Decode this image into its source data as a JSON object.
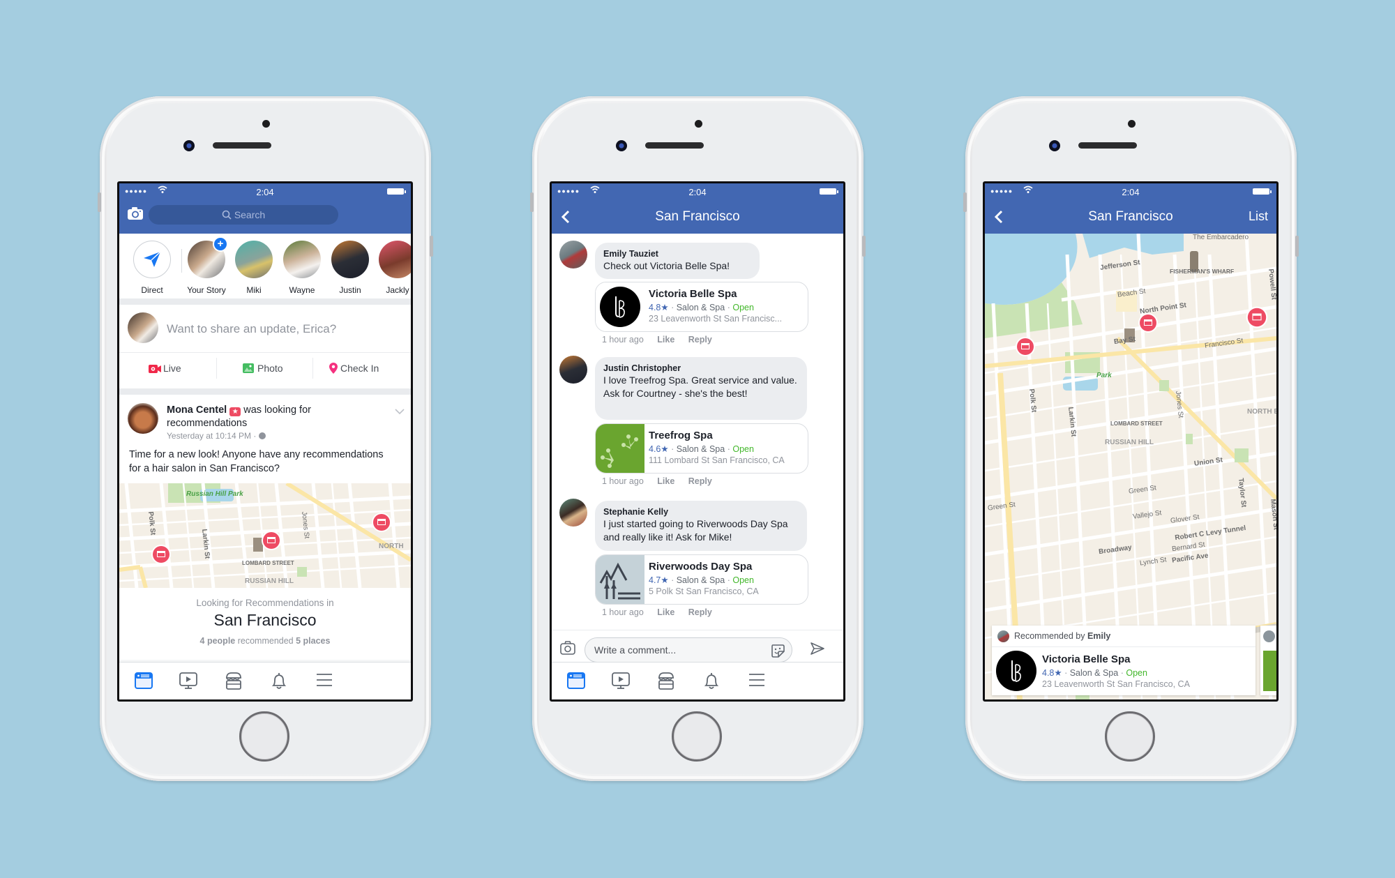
{
  "colors": {
    "background": "#a4cde0",
    "fb_blue": "#4267b2",
    "pin_red": "#ee4b63",
    "open_green": "#42b72a"
  },
  "status_bar": {
    "time": "2:04",
    "signal": "●●●●●",
    "wifi_icon": "wifi-icon",
    "battery_icon": "battery-icon"
  },
  "phone1": {
    "search_placeholder": "Search",
    "camera_icon": "camera-icon",
    "stories": [
      {
        "name": "Direct",
        "icon": "send-icon"
      },
      {
        "name": "Your Story",
        "badge": "+"
      },
      {
        "name": "Miki"
      },
      {
        "name": "Wayne"
      },
      {
        "name": "Justin"
      },
      {
        "name": "Jackly"
      }
    ],
    "composer_placeholder": "Want to share an update, Erica?",
    "actions": [
      {
        "label": "Live",
        "icon": "live-video-icon"
      },
      {
        "label": "Photo",
        "icon": "photo-icon"
      },
      {
        "label": "Check In",
        "icon": "location-pin-icon"
      }
    ],
    "post": {
      "author": "Mona Centel",
      "action": "was looking for recommendations",
      "timestamp": "Yesterday at 10:14 PM",
      "separator": "·",
      "text": "Time for a new look! Anyone have any recommendations for a hair salon in San Francisco?"
    },
    "map_labels": {
      "park": "Russian Hill Park",
      "polk": "Polk St",
      "larkin": "Larkin St",
      "jones": "Jones St",
      "lombard": "LOMBARD STREET",
      "russian_hill": "RUSSIAN HILL",
      "north": "NORTH"
    },
    "recommendations": {
      "subtitle": "Looking for Recommendations in",
      "city": "San Francisco",
      "people": "4 people",
      "mid": "recommended",
      "places": "5 places"
    }
  },
  "phone2": {
    "title": "San Francisco",
    "comments": [
      {
        "author": "Emily Tauziet",
        "text": "Check out Victoria Belle Spa!",
        "place": {
          "name": "Victoria Belle Spa",
          "rating": "4.8★",
          "category": "Salon & Spa",
          "status": "Open",
          "address": "23 Leavenworth St San Francisc..."
        },
        "time": "1 hour ago",
        "like": "Like",
        "reply": "Reply"
      },
      {
        "author": "Justin Christopher",
        "text": "I love Treefrog Spa. Great service and value. Ask for Courtney - she's the best!",
        "place": {
          "name": "Treefrog Spa",
          "rating": "4.6★",
          "category": "Salon & Spa",
          "status": "Open",
          "address": "111 Lombard St San Francisco, CA"
        },
        "time": "1 hour ago",
        "like": "Like",
        "reply": "Reply"
      },
      {
        "author": "Stephanie Kelly",
        "text": "I just started going to Riverwoods Day Spa and really like it! Ask for Mike!",
        "place": {
          "name": "Riverwoods Day Spa",
          "rating": "4.7★",
          "category": "Salon & Spa",
          "status": "Open",
          "address": "5 Polk St San Francisco, CA"
        },
        "time": "1 hour ago",
        "like": "Like",
        "reply": "Reply"
      }
    ],
    "comment_placeholder": "Write a comment..."
  },
  "phone3": {
    "title": "San Francisco",
    "list_button": "List",
    "map_labels": {
      "embarcadero": "The Embarcadero",
      "jefferson": "Jefferson St",
      "fishermans": "FISHERMAN'S WHARF",
      "powell": "Powell St",
      "beach": "Beach St",
      "north_point": "North Point St",
      "bay": "Bay St",
      "francisco": "Francisco St",
      "park": "Park",
      "polk": "Polk St",
      "larkin": "Larkin St",
      "jones": "Jones St",
      "lombard": "LOMBARD STREET",
      "russian_hill": "RUSSIAN HILL",
      "north": "NORTH B",
      "union": "Union St",
      "green": "Green St",
      "green_left": "Green St",
      "vallejo": "Vallejo St",
      "glover": "Glover St",
      "taylor": "Taylor St",
      "mason": "Mason St",
      "tunnel": "Robert C Levy Tunnel",
      "broadway": "Broadway",
      "bernard": "Bernard St",
      "lynch": "Lynch St",
      "pacific": "Pacific Ave"
    },
    "card": {
      "recommended_prefix": "Recommended by",
      "recommended_by": "Emily",
      "place": {
        "name": "Victoria Belle Spa",
        "rating": "4.8★",
        "category": "Salon & Spa",
        "status": "Open",
        "address": "23 Leavenworth St San Francisco, CA"
      }
    }
  },
  "tabbar": [
    {
      "name": "news-feed",
      "icon": "news-feed-icon",
      "active": true
    },
    {
      "name": "watch",
      "icon": "video-play-icon"
    },
    {
      "name": "marketplace",
      "icon": "marketplace-icon"
    },
    {
      "name": "notifications",
      "icon": "bell-icon"
    },
    {
      "name": "menu",
      "icon": "hamburger-menu-icon"
    }
  ]
}
